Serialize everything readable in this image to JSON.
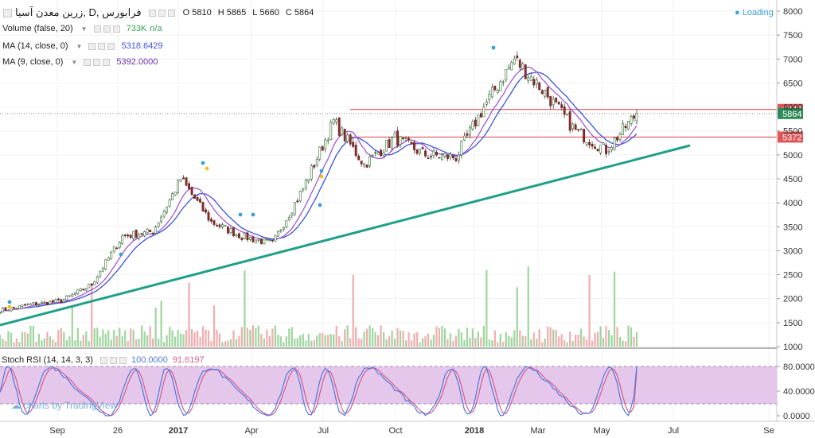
{
  "header": {
    "symbol": "زرین معدن آسیا, D, فرابورس",
    "o_label": "O",
    "o": "5810",
    "h_label": "H",
    "h": "5865",
    "l_label": "L",
    "l": "5660",
    "c_label": "C",
    "c": "5864"
  },
  "indicators": {
    "volume": {
      "label": "Volume (false, 20)",
      "value": "733K",
      "value2": "n/a"
    },
    "ma14": {
      "label": "MA (14, close, 0)",
      "value": "5318.6429"
    },
    "ma9": {
      "label": "MA (9, close, 0)",
      "value": "5392.0000"
    }
  },
  "status": {
    "loading": "Loading"
  },
  "watermark": "charts by TradingView",
  "colors": {
    "up": "#5fb65f",
    "down": "#e0635f",
    "trendline": "#20a088",
    "ma14": "#3b54d8",
    "ma9": "#a457d1",
    "level": "#e05656",
    "current": "#2e8b57",
    "stoch_k": "#4f7be0",
    "stoch_d": "#d65c8e",
    "stoch_band": "#e4c7ea",
    "marker": "#3aa0d6",
    "marker_alt": "#f0c020"
  },
  "chart_data": {
    "type": "candlestick",
    "price_axis": {
      "ticks": [
        "8000",
        "7500",
        "7000",
        "6500",
        "6000",
        "5500",
        "5000",
        "4500",
        "4000",
        "3500",
        "3000",
        "2500",
        "2000",
        "1500",
        "1000"
      ],
      "range": [
        1000,
        8000
      ]
    },
    "time_axis": {
      "ticks": [
        "Sep",
        "26",
        "2017",
        "Apr",
        "Jul",
        "Oct",
        "2018",
        "Mar",
        "May",
        "Jul",
        "Se"
      ]
    },
    "key_points": [
      {
        "t": "Aug 2016",
        "close": 1750
      },
      {
        "t": "Sep 2016",
        "close": 1880
      },
      {
        "t": "Oct 2016",
        "close": 1950
      },
      {
        "t": "Nov 2016",
        "close": 2300
      },
      {
        "t": "Dec 2016",
        "close": 3300
      },
      {
        "t": "Jan 2017",
        "close": 3400
      },
      {
        "t": "Feb 2017",
        "close": 4500
      },
      {
        "t": "Mar 2017",
        "close": 3600
      },
      {
        "t": "Apr 2017",
        "close": 3300
      },
      {
        "t": "Jun 2017",
        "close": 3150
      },
      {
        "t": "Jul 2017",
        "close": 4300
      },
      {
        "t": "Aug 2017",
        "close": 5700
      },
      {
        "t": "Sep 2017",
        "close": 4800
      },
      {
        "t": "Oct 2017",
        "close": 5350
      },
      {
        "t": "Nov 2017",
        "close": 5000
      },
      {
        "t": "Dec 2017",
        "close": 4950
      },
      {
        "t": "Jan 2018",
        "close": 6000
      },
      {
        "t": "Feb 2018",
        "close": 7000
      },
      {
        "t": "Mar 2018",
        "close": 6300
      },
      {
        "t": "Apr 2018",
        "close": 5500
      },
      {
        "t": "May 2018",
        "close": 5100
      },
      {
        "t": "Jun 2018",
        "close": 5864
      }
    ],
    "horizontal_levels": [
      {
        "value": 5948,
        "label": "5948"
      },
      {
        "value": 5372,
        "label": "5372"
      }
    ],
    "current_price": {
      "value": 5864,
      "label": "5864"
    },
    "trendline": [
      {
        "t": "Aug 2016",
        "price": 1400
      },
      {
        "t": "Jul 2018",
        "price": 5200
      }
    ],
    "stoch_rsi": {
      "label": "Stoch RSI (14, 14, 3, 3)",
      "k": "100.0000",
      "d": "91.6197",
      "axis_ticks": [
        "80.0000",
        "40.0000",
        "0.0000"
      ],
      "band": [
        20,
        80
      ]
    }
  }
}
